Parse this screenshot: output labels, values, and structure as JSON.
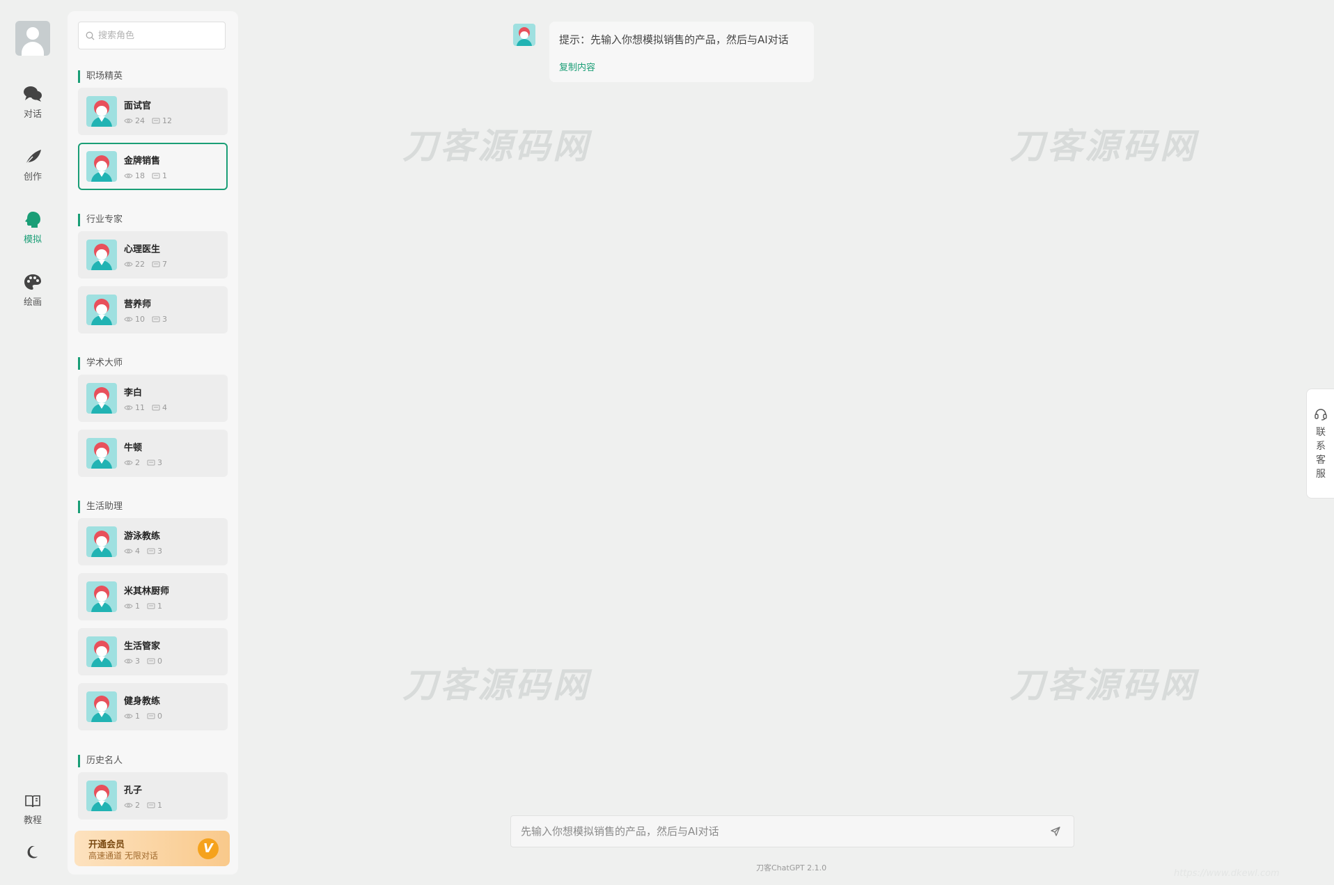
{
  "nav": {
    "items": [
      {
        "label": "对话",
        "icon": "chat-icon"
      },
      {
        "label": "创作",
        "icon": "feather-icon"
      },
      {
        "label": "模拟",
        "icon": "head-icon"
      },
      {
        "label": "绘画",
        "icon": "palette-icon"
      }
    ],
    "active": "模拟",
    "tutorial_label": "教程",
    "theme_icon": "moon-icon"
  },
  "search": {
    "placeholder": "搜索角色"
  },
  "sections": [
    {
      "title": "职场精英",
      "roles": [
        {
          "name": "面试官",
          "views": "24",
          "chats": "12"
        },
        {
          "name": "金牌销售",
          "views": "18",
          "chats": "1",
          "selected": true
        }
      ]
    },
    {
      "title": "行业专家",
      "roles": [
        {
          "name": "心理医生",
          "views": "22",
          "chats": "7"
        },
        {
          "name": "营养师",
          "views": "10",
          "chats": "3"
        }
      ]
    },
    {
      "title": "学术大师",
      "roles": [
        {
          "name": "李白",
          "views": "11",
          "chats": "4"
        },
        {
          "name": "牛顿",
          "views": "2",
          "chats": "3"
        }
      ]
    },
    {
      "title": "生活助理",
      "roles": [
        {
          "name": "游泳教练",
          "views": "4",
          "chats": "3"
        },
        {
          "name": "米其林厨师",
          "views": "1",
          "chats": "1"
        },
        {
          "name": "生活管家",
          "views": "3",
          "chats": "0"
        },
        {
          "name": "健身教练",
          "views": "1",
          "chats": "0"
        }
      ]
    },
    {
      "title": "历史名人",
      "roles": [
        {
          "name": "孔子",
          "views": "2",
          "chats": "1"
        }
      ]
    }
  ],
  "vip": {
    "title": "开通会员",
    "subtitle": "高速通道 无限对话",
    "badge": "V"
  },
  "chat": {
    "message": "提示：先输入你想模拟销售的产品，然后与AI对话",
    "copy_label": "复制内容"
  },
  "watermark": "刀客源码网",
  "contact": {
    "label": "联系客服"
  },
  "composer": {
    "placeholder": "先输入你想模拟销售的产品，然后与AI对话"
  },
  "footer": {
    "version": "刀客ChatGPT 2.1.0",
    "faint_url": "https://www.dkewl.com"
  },
  "colors": {
    "accent": "#1a9e76",
    "background": "#eff0ef",
    "vip_gold": "#f5a21c"
  }
}
